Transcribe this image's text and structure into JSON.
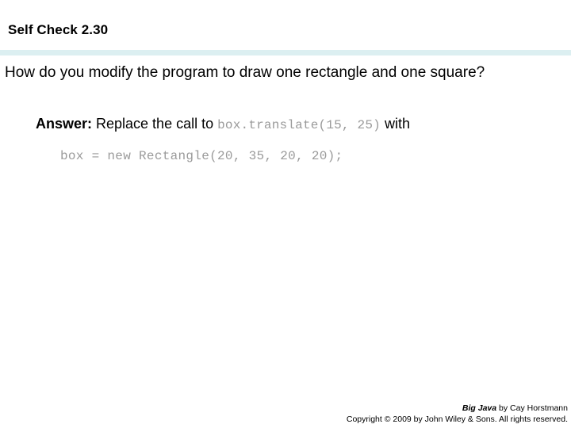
{
  "slide": {
    "title": "Self Check 2.30",
    "divider_color": "#dceff1",
    "question": "How do you modify the program to draw one rectangle and one square?",
    "answer": {
      "label": "Answer:",
      "text_before_code": " Replace the call to ",
      "inline_code": "box.translate(15, 25)",
      "text_after_code": " with",
      "code_block": "box = new Rectangle(20, 35, 20, 20);",
      "code_color": "#9a9a9a"
    }
  },
  "footer": {
    "book_title": "Big Java",
    "byline": " by Cay Horstmann",
    "copyright": "Copyright © 2009 by John Wiley & Sons.  All rights reserved."
  }
}
